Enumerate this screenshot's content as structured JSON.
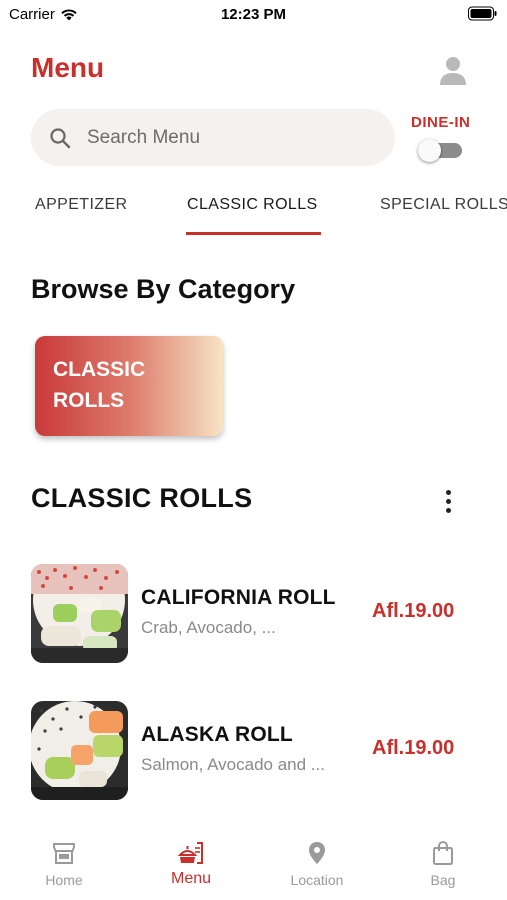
{
  "status_bar": {
    "carrier": "Carrier",
    "time": "12:23 PM"
  },
  "header": {
    "title": "Menu",
    "profile_icon": "user-icon"
  },
  "search": {
    "placeholder": "Search Menu",
    "value": ""
  },
  "dine_in": {
    "label": "DINE-IN",
    "enabled": false
  },
  "tabs": [
    {
      "label": "APPETIZER",
      "active": false
    },
    {
      "label": "CLASSIC ROLLS",
      "active": true
    },
    {
      "label": "SPECIAL ROLLS",
      "active": false
    }
  ],
  "browse": {
    "heading": "Browse By Category",
    "categories": [
      {
        "label": "CLASSIC ROLLS"
      }
    ]
  },
  "list": {
    "heading": "CLASSIC ROLLS",
    "items": [
      {
        "name": "CALIFORNIA ROLL",
        "description": "Crab, Avocado, ...",
        "price": "Afl.19.00"
      },
      {
        "name": "ALASKA ROLL",
        "description": "Salmon, Avocado and ...",
        "price": "Afl.19.00"
      }
    ]
  },
  "bottom_nav": [
    {
      "label": "Home",
      "icon": "store-icon",
      "active": false
    },
    {
      "label": "Menu",
      "icon": "menu-food-icon",
      "active": true
    },
    {
      "label": "Location",
      "icon": "location-pin-icon",
      "active": false
    },
    {
      "label": "Bag",
      "icon": "shopping-bag-icon",
      "active": false
    }
  ],
  "colors": {
    "accent": "#c9302c",
    "search_bg": "#f4f1ee",
    "inactive_nav": "#9a9a9a"
  }
}
